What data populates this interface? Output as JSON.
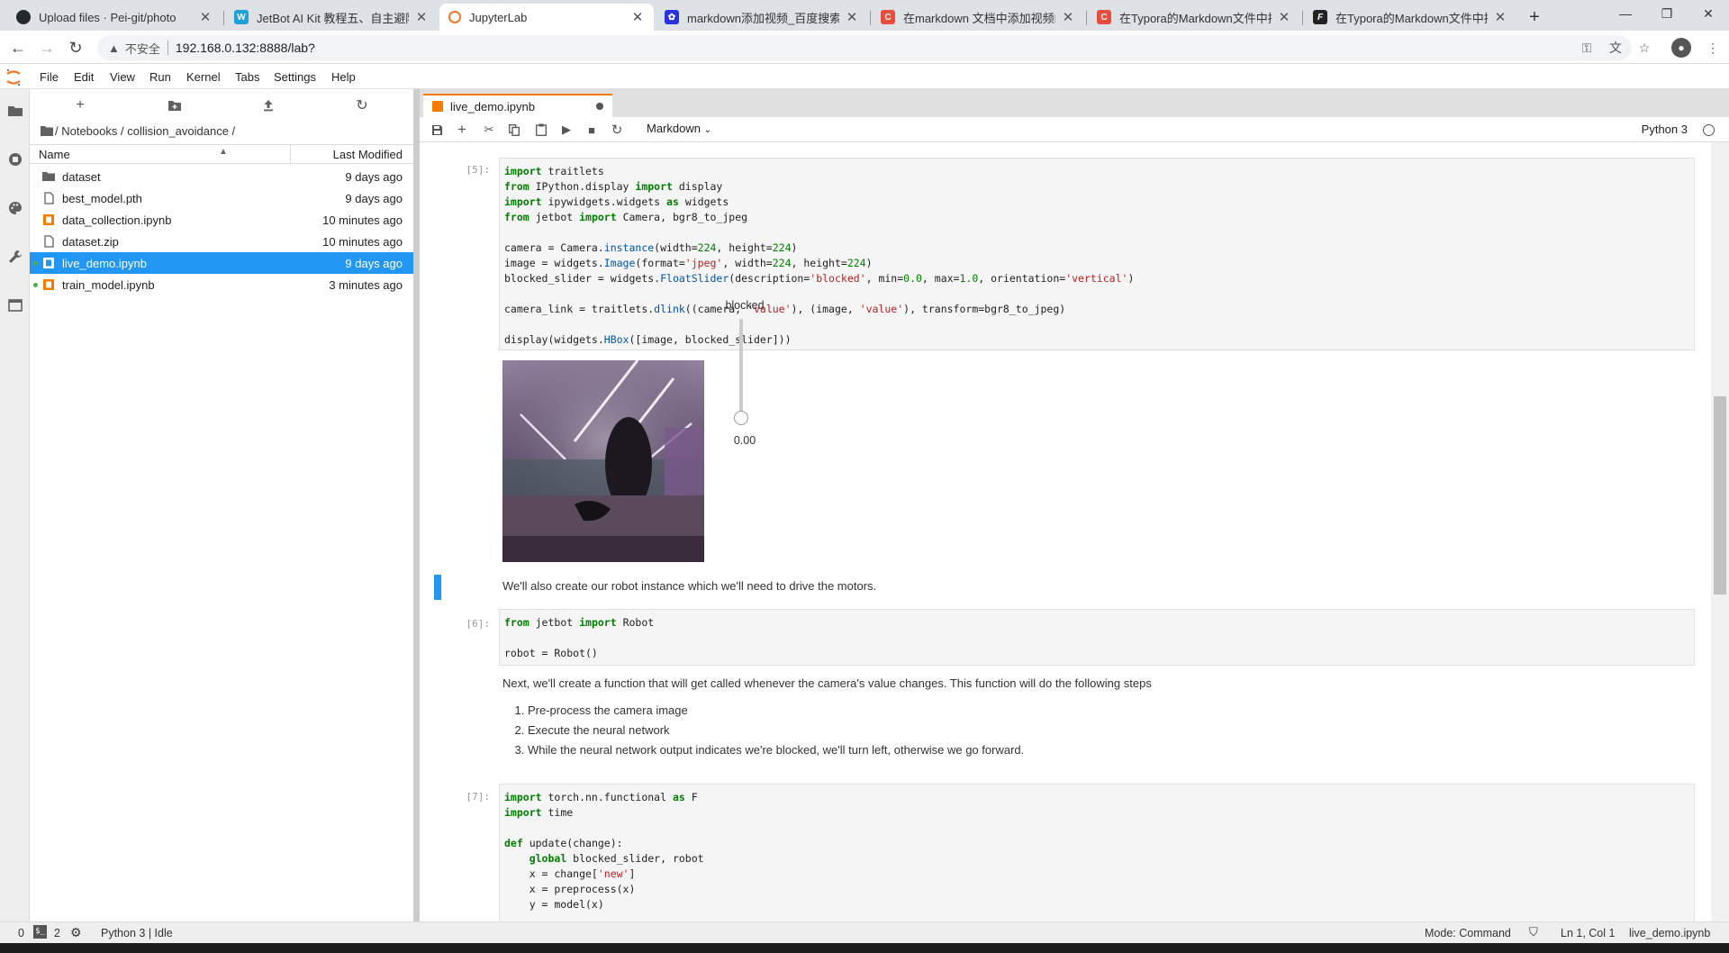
{
  "browser": {
    "tabs": [
      {
        "title": "Upload files · Pei-git/photo",
        "icon": "github-icon"
      },
      {
        "title": "JetBot AI Kit 教程五、自主避障",
        "icon": "waveshare-icon"
      },
      {
        "title": "JupyterLab",
        "icon": "jupyter-icon"
      },
      {
        "title": "markdown添加视频_百度搜索",
        "icon": "baidu-icon"
      },
      {
        "title": "在markdown 文档中添加视频的",
        "icon": "csdn-icon"
      },
      {
        "title": "在Typora的Markdown文件中插",
        "icon": "csdn-icon"
      },
      {
        "title": "在Typora的Markdown文件中插",
        "icon": "segmentfault-icon"
      }
    ],
    "insecure_label": "不安全",
    "url": "192.168.0.132:8888/lab?",
    "colors": {
      "tabstrip": "#dee1e6",
      "active_tab": "#ffffff"
    }
  },
  "jupyter": {
    "menu": [
      "File",
      "Edit",
      "View",
      "Run",
      "Kernel",
      "Tabs",
      "Settings",
      "Help"
    ],
    "breadcrumb": "/ Notebooks / collision_avoidance /",
    "file_columns": {
      "name": "Name",
      "modified": "Last Modified"
    },
    "files": [
      {
        "name": "dataset",
        "modified": "9 days ago",
        "type": "folder",
        "running": false,
        "selected": false
      },
      {
        "name": "best_model.pth",
        "modified": "9 days ago",
        "type": "file",
        "running": false,
        "selected": false
      },
      {
        "name": "data_collection.ipynb",
        "modified": "10 minutes ago",
        "type": "notebook",
        "running": false,
        "selected": false
      },
      {
        "name": "dataset.zip",
        "modified": "10 minutes ago",
        "type": "file",
        "running": false,
        "selected": false
      },
      {
        "name": "live_demo.ipynb",
        "modified": "9 days ago",
        "type": "notebook",
        "running": true,
        "selected": true
      },
      {
        "name": "train_model.ipynb",
        "modified": "3 minutes ago",
        "type": "notebook",
        "running": true,
        "selected": false
      }
    ],
    "notebook_tab": "live_demo.ipynb",
    "cell_type": "Markdown",
    "kernel": "Python 3",
    "accent": "#2196f3",
    "notebook_tab_accent": "#f57c00"
  },
  "cells": {
    "c1_prompt": "[5]:",
    "c1_lines": [
      "import traitlets",
      "from IPython.display import display",
      "import ipywidgets.widgets as widgets",
      "from jetbot import Camera, bgr8_to_jpeg",
      "",
      "camera = Camera.instance(width=224, height=224)",
      "image = widgets.Image(format='jpeg', width=224, height=224)",
      "blocked_slider = widgets.FloatSlider(description='blocked', min=0.0, max=1.0, orientation='vertical')",
      "",
      "camera_link = traitlets.dlink((camera, 'value'), (image, 'value'), transform=bgr8_to_jpeg)",
      "",
      "display(widgets.HBox([image, blocked_slider]))"
    ],
    "slider_label": "blocked",
    "slider_value_text": "0.00",
    "slider_level": 0.0,
    "md1": "We'll also create our robot instance which we'll need to drive the motors.",
    "c2_prompt": "[6]:",
    "c2_lines": [
      "from jetbot import Robot",
      "",
      "robot = Robot()"
    ],
    "md2": "Next, we'll create a function that will get called whenever the camera's value changes. This function will do the following steps",
    "md2_list": [
      "Pre-process the camera image",
      "Execute the neural network",
      "While the neural network output indicates we're blocked, we'll turn left, otherwise we go forward."
    ],
    "c3_prompt": "[7]:",
    "c3_lines": [
      "import torch.nn.functional as F",
      "import time",
      "",
      "def update(change):",
      "    global blocked_slider, robot",
      "    x = change['new']",
      "    x = preprocess(x)",
      "    y = model(x)"
    ]
  },
  "status": {
    "left_count": "0",
    "terminals": "2",
    "kernel_status": "Python 3 | Idle",
    "mode": "Mode: Command",
    "cursor": "Ln 1, Col 1",
    "file": "live_demo.ipynb"
  }
}
